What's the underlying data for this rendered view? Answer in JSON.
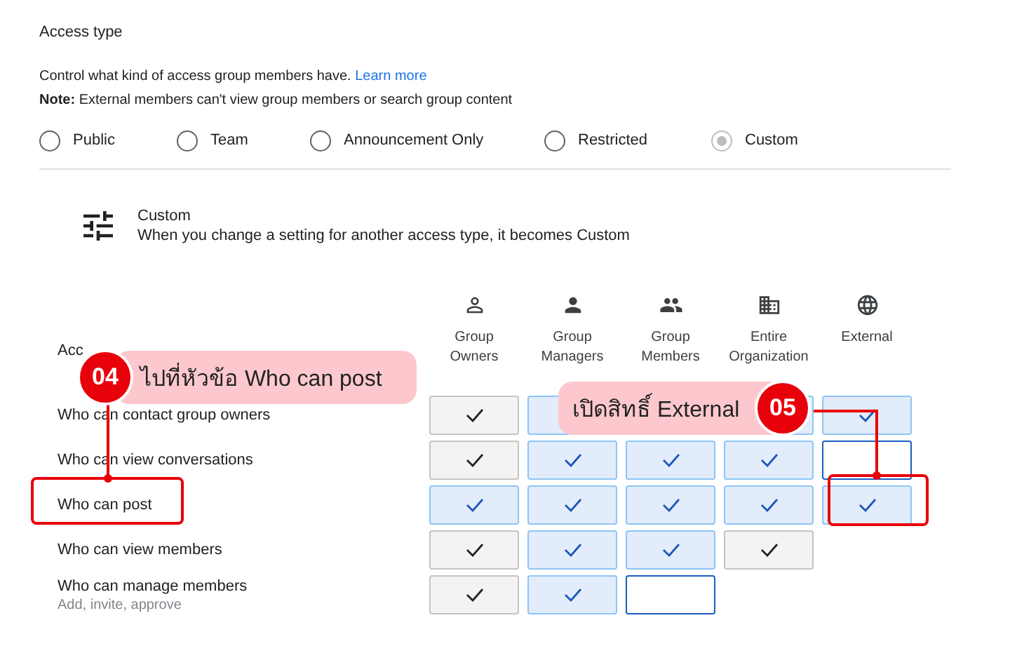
{
  "section": {
    "title": "Access type",
    "description": "Control what kind of access group members have.",
    "learn_more": "Learn more",
    "note": "**Note:** External members can't view group members or search group content"
  },
  "access_types": [
    {
      "label": "Public",
      "selected": false,
      "disabled": false
    },
    {
      "label": "Team",
      "selected": false,
      "disabled": false
    },
    {
      "label": "Announcement Only",
      "selected": false,
      "disabled": false
    },
    {
      "label": "Restricted",
      "selected": false,
      "disabled": false
    },
    {
      "label": "Custom",
      "selected": true,
      "disabled": true
    }
  ],
  "custom": {
    "title": "Custom",
    "description": "When you change a setting for another access type, it becomes Custom"
  },
  "table": {
    "header": "Acc",
    "columns": [
      {
        "label": "Group Owners"
      },
      {
        "label": "Group Managers"
      },
      {
        "label": "Group Members"
      },
      {
        "label": "Entire Organization"
      },
      {
        "label": "External"
      }
    ],
    "rows": [
      {
        "label": "Who can contact group owners",
        "cells": [
          {
            "kind": "fixed",
            "checked": true
          },
          {
            "kind": "covered"
          },
          null,
          {
            "kind": "covered"
          },
          {
            "kind": "toggle",
            "checked": true
          }
        ]
      },
      {
        "label": "Who can view conversations",
        "cells": [
          {
            "kind": "fixed",
            "checked": true
          },
          {
            "kind": "toggle",
            "checked": true
          },
          {
            "kind": "toggle",
            "checked": true
          },
          {
            "kind": "toggle",
            "checked": true
          },
          {
            "kind": "toggle",
            "checked": false
          }
        ]
      },
      {
        "label": "Who can post",
        "cells": [
          {
            "kind": "toggle",
            "checked": true
          },
          {
            "kind": "toggle",
            "checked": true
          },
          {
            "kind": "toggle",
            "checked": true
          },
          {
            "kind": "toggle",
            "checked": true
          },
          {
            "kind": "toggle",
            "checked": true
          }
        ]
      },
      {
        "label": "Who can view members",
        "cells": [
          {
            "kind": "fixed",
            "checked": true
          },
          {
            "kind": "toggle",
            "checked": true
          },
          {
            "kind": "toggle",
            "checked": true
          },
          {
            "kind": "fixed",
            "checked": true
          }
        ]
      },
      {
        "label": "Who can manage members",
        "sublabel": "Add, invite, approve",
        "cells": [
          {
            "kind": "fixed",
            "checked": true
          },
          {
            "kind": "toggle",
            "checked": true
          },
          {
            "kind": "toggle",
            "checked": false
          }
        ]
      }
    ]
  },
  "callouts": [
    {
      "number": "04",
      "text": "ไปที่หัวข้อ Who can post"
    },
    {
      "number": "05",
      "text": "เปิดสิทธิ์ External"
    }
  ]
}
